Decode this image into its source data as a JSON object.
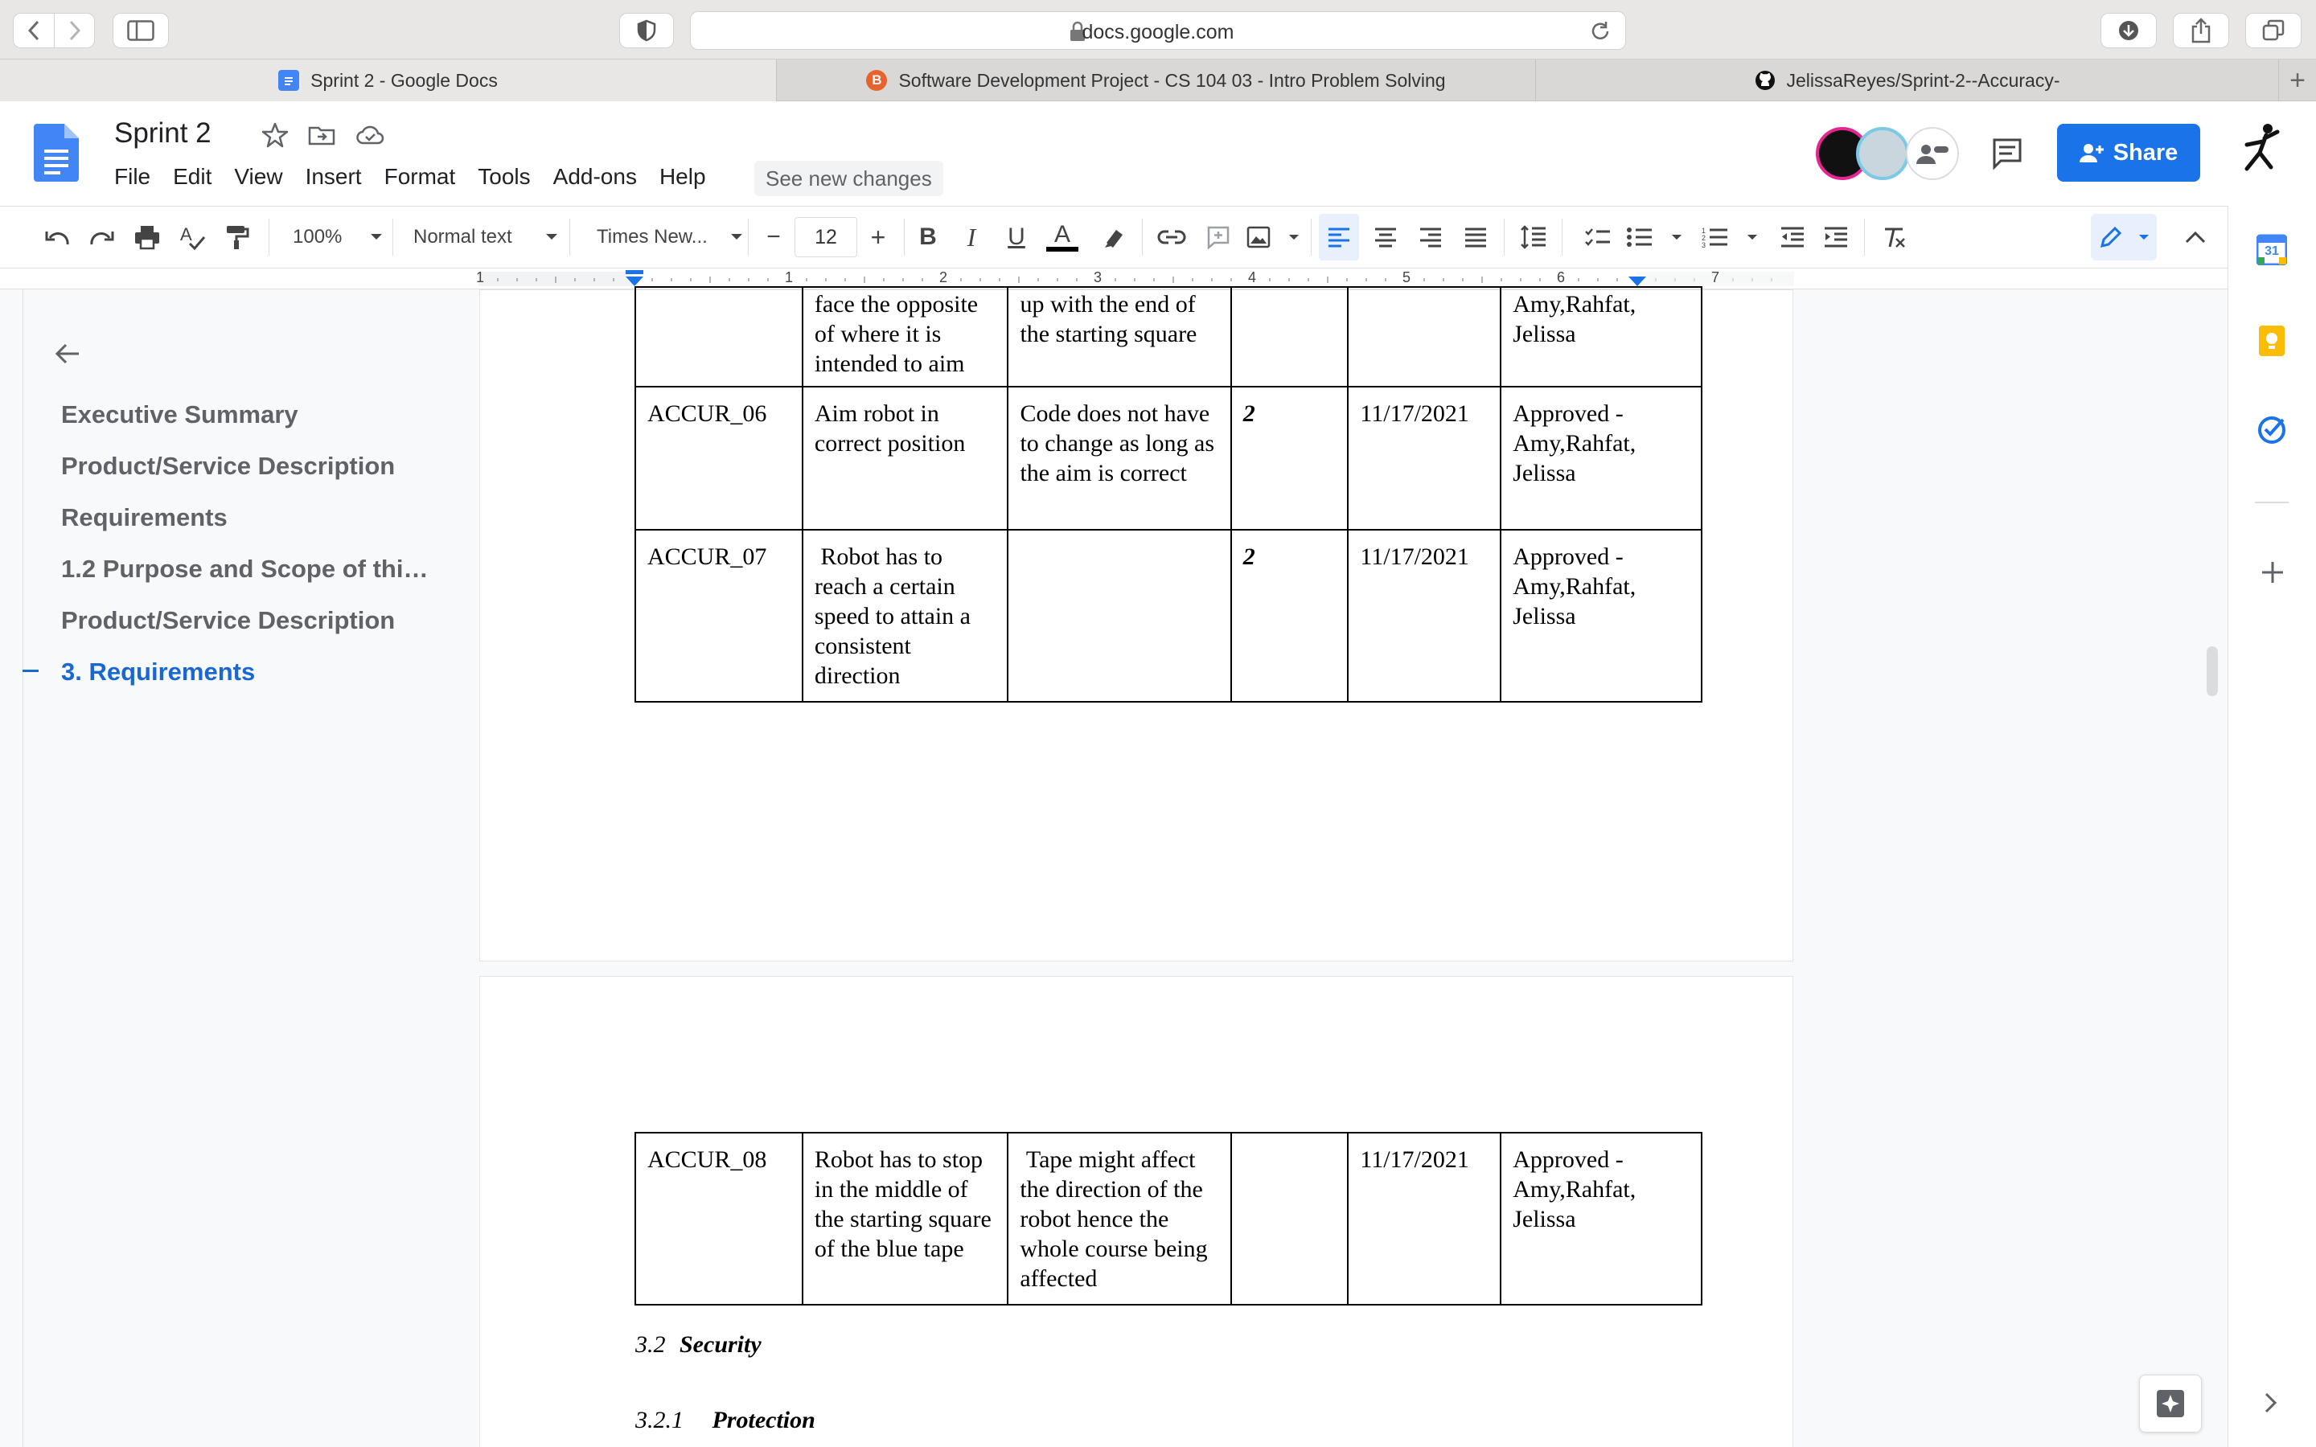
{
  "browser": {
    "url": "docs.google.com",
    "tabs": [
      {
        "label": "Sprint 2 - Google Docs"
      },
      {
        "label": "Software Development Project - CS 104 03 - Intro Problem Solving"
      },
      {
        "label": "JelissaReyes/Sprint-2--Accuracy-"
      }
    ]
  },
  "docs": {
    "title": "Sprint 2",
    "menu": [
      "File",
      "Edit",
      "View",
      "Insert",
      "Format",
      "Tools",
      "Add-ons",
      "Help"
    ],
    "see_new_changes": "See new changes",
    "share_label": "Share"
  },
  "toolbar": {
    "zoom": "100%",
    "style": "Normal text",
    "font": "Times New...",
    "font_size": "12",
    "minus": "−",
    "plus": "+"
  },
  "ruler": {
    "numbers": [
      "1",
      "1",
      "2",
      "3",
      "4",
      "5",
      "6",
      "7"
    ]
  },
  "outline": {
    "items": [
      "Executive Summary",
      "Product/Service Description",
      "Requirements",
      "1.2 Purpose and Scope of thi…",
      "Product/Service Description",
      "3. Requirements"
    ]
  },
  "table_top": {
    "rows": [
      [
        "",
        "face the opposite of where it is intended to aim",
        "up with the end of the starting square",
        "",
        "",
        "Amy,Rahfat, Jelissa"
      ],
      [
        "ACCUR_06",
        "Aim robot in correct position",
        "Code does not have to change as long as the aim is correct",
        "2",
        "11/17/2021",
        "Approved - Amy,Rahfat, Jelissa"
      ],
      [
        "ACCUR_07",
        " Robot has to reach a certain speed to attain a consistent direction",
        "",
        "2",
        "11/17/2021",
        "Approved - Amy,Rahfat, Jelissa"
      ]
    ]
  },
  "table_bottom": {
    "rows": [
      [
        "ACCUR_08",
        "Robot has to stop in the middle of the starting square of the blue tape",
        " Tape might affect the direction of the robot hence the whole course being affected",
        "",
        "11/17/2021",
        "Approved - Amy,Rahfat, Jelissa"
      ]
    ]
  },
  "sections": {
    "security_num": "3.2",
    "security_title": "Security",
    "protection_num": "3.2.1",
    "protection_title": "Protection"
  },
  "calendar_day": "31"
}
